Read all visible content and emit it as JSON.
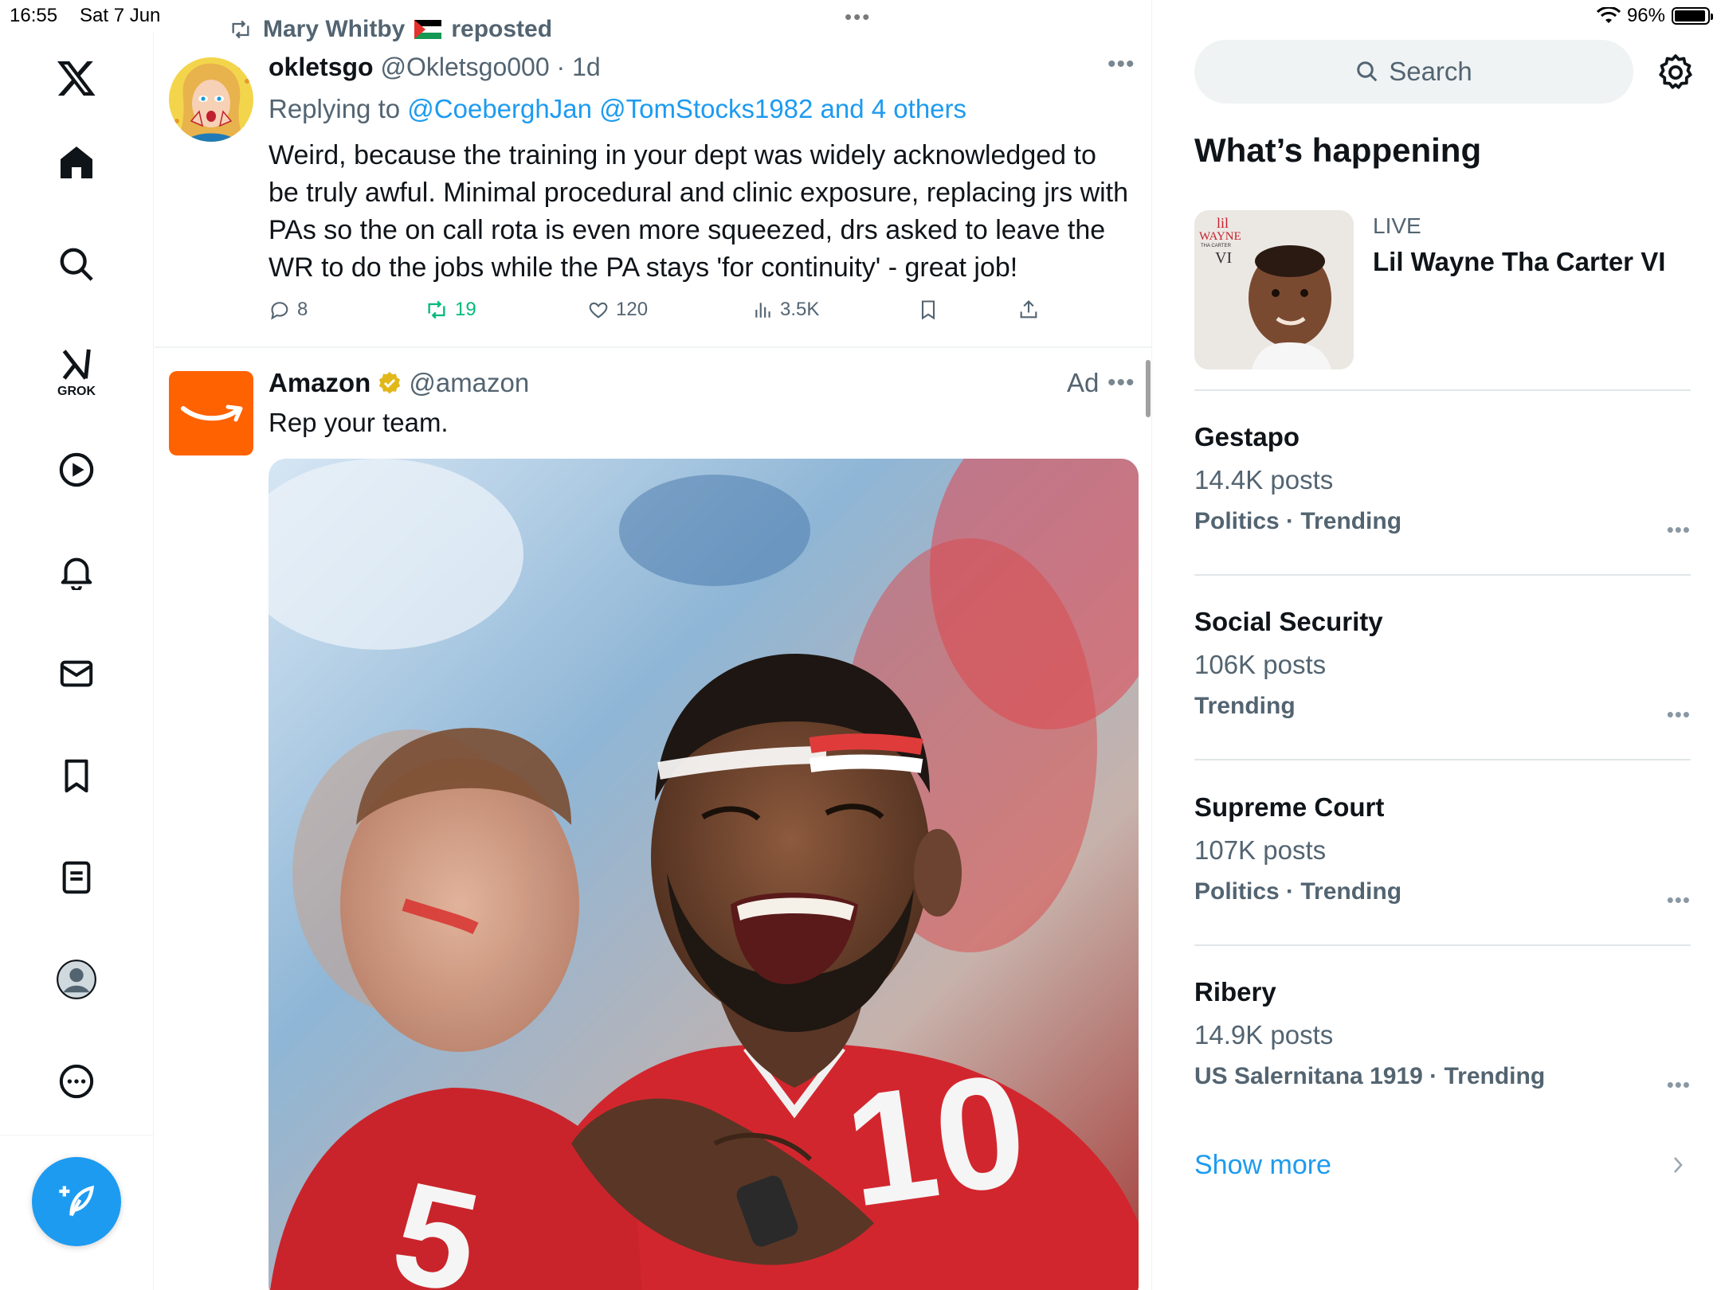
{
  "status_bar": {
    "time": "16:55",
    "date": "Sat 7 Jun",
    "battery": "96%",
    "battery_level": 0.96
  },
  "nav": {
    "grok_label": "GROK",
    "items": [
      "x-logo",
      "home-icon",
      "search-icon",
      "grok-icon",
      "video-icon",
      "notifications-icon",
      "messages-icon",
      "bookmarks-icon",
      "lists-icon",
      "profile-icon",
      "more-icon"
    ],
    "compose": "compose-icon"
  },
  "feed": {
    "repost_by": "Mary Whitby",
    "repost_suffix": "reposted",
    "tweet1": {
      "name": "okletsgo",
      "handle": "@Okletsgo000",
      "time": "· 1d",
      "replying_prefix": "Replying to",
      "replying_to": "@CoeberghJan @TomStocks1982 and 4 others",
      "text": "Weird, because the training in your dept was widely acknowledged to be truly awful. Minimal procedural and clinic exposure, replacing jrs with PAs so the on call rota is even more squeezed, drs asked to leave the WR to do the jobs while the PA stays 'for continuity' - great job!",
      "replies": "8",
      "reposts": "19",
      "likes": "120",
      "views": "3.5K"
    },
    "ad": {
      "name": "Amazon",
      "handle": "@amazon",
      "ad_label": "Ad",
      "text": "Rep your team.",
      "jersey_numbers": [
        "10",
        "5"
      ]
    }
  },
  "sidebar": {
    "search_placeholder": "Search",
    "heading": "What’s happening",
    "live": {
      "label": "LIVE",
      "title": "Lil Wayne Tha Carter VI",
      "thumb_text": [
        "lil",
        "WAYNE",
        "THA CARTER",
        "VI"
      ]
    },
    "trends": [
      {
        "name": "Gestapo",
        "count": "14.4K posts",
        "meta": "Politics · Trending"
      },
      {
        "name": "Social Security",
        "count": "106K posts",
        "meta": "Trending"
      },
      {
        "name": "Supreme Court",
        "count": "107K posts",
        "meta": "Politics · Trending"
      },
      {
        "name": "Ribery",
        "count": "14.9K posts",
        "meta": "US Salernitana 1919 · Trending"
      }
    ],
    "show_more": "Show more"
  },
  "colors": {
    "accent": "#1d9bf0",
    "repost_green": "#00ba7c",
    "amazon_orange": "#ff6200",
    "secondary_text": "#536471"
  }
}
